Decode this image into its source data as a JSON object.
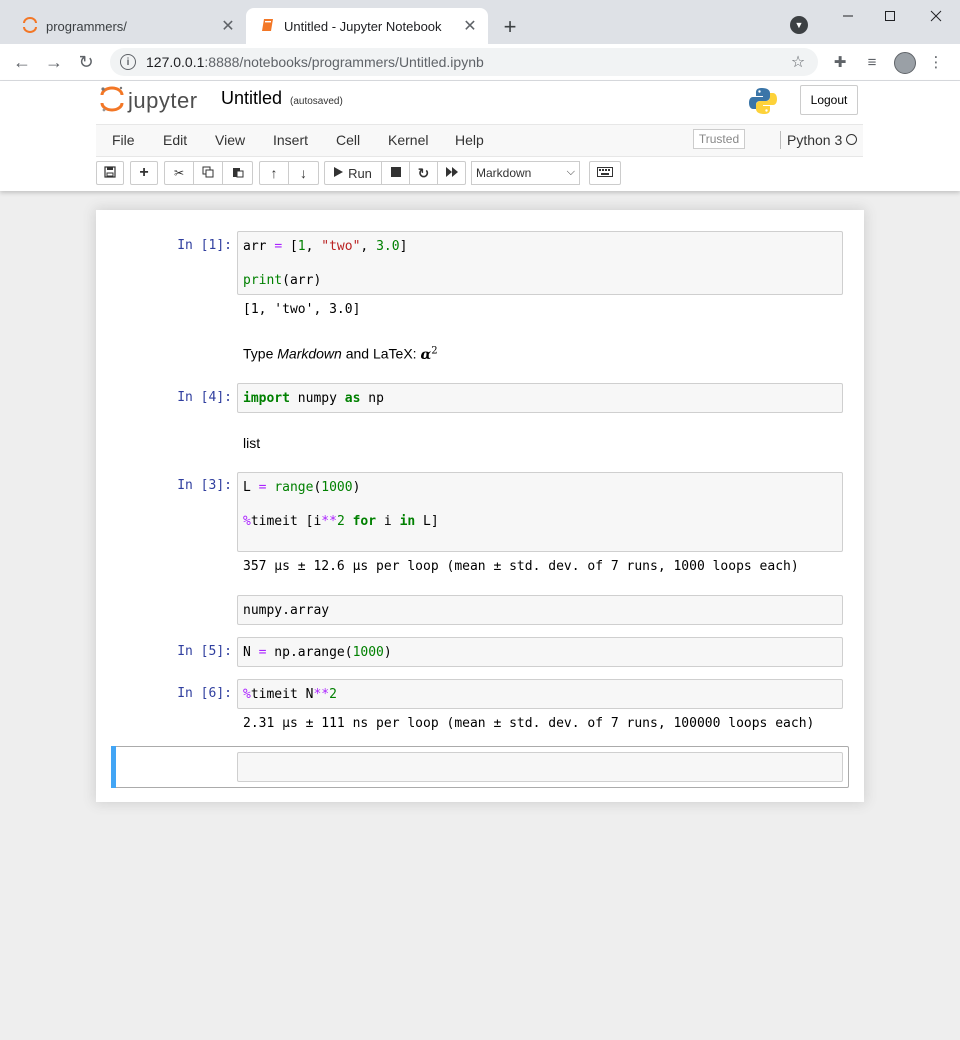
{
  "browser": {
    "tabs": [
      {
        "title": "programmers/",
        "active": false
      },
      {
        "title": "Untitled - Jupyter Notebook",
        "active": true
      }
    ],
    "url_host": "127.0.0.1",
    "url_rest": ":8888/notebooks/programmers/Untitled.ipynb"
  },
  "jupyter": {
    "logo_text": "jupyter",
    "notebook_title": "Untitled",
    "autosave_status": "(autosaved)",
    "logout_label": "Logout",
    "menu": [
      "File",
      "Edit",
      "View",
      "Insert",
      "Cell",
      "Kernel",
      "Help"
    ],
    "trusted_label": "Trusted",
    "kernel_name": "Python 3",
    "run_label": "Run",
    "cell_type": "Markdown"
  },
  "cells": {
    "c1": {
      "prompt": "In [1]:",
      "output": "[1, 'two', 3.0]"
    },
    "md1": {
      "prefix": "Type ",
      "em": "Markdown",
      "suffix": " and LaTeX: "
    },
    "c2": {
      "prompt": "In [4]:"
    },
    "md2": {
      "text": "list"
    },
    "c3": {
      "prompt": "In [3]:",
      "output": "357 µs ± 12.6 µs per loop (mean ± std. dev. of 7 runs, 1000 loops each)"
    },
    "raw1": {
      "text": "numpy.array"
    },
    "c4": {
      "prompt": "In [5]:"
    },
    "c5": {
      "prompt": "In [6]:",
      "output": "2.31 µs ± 111 ns per loop (mean ± std. dev. of 7 runs, 100000 loops each)"
    }
  },
  "colors": {
    "prompt": "#303f9f",
    "selected_bar": "#42a5f5",
    "keyword": "#008000",
    "string": "#ba2121",
    "magic": "#aa22ff"
  }
}
